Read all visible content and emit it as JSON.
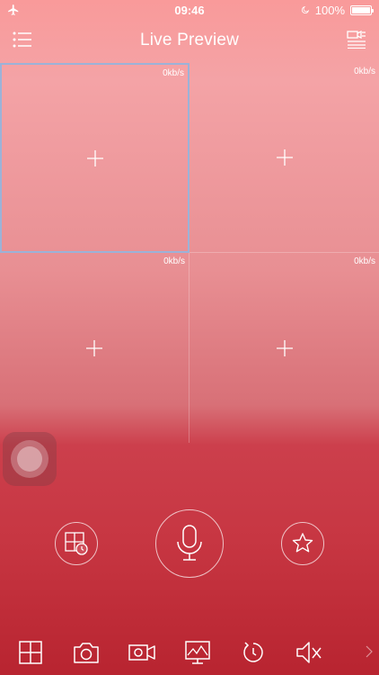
{
  "status_bar": {
    "time": "09:46",
    "battery": "100%",
    "icons": [
      "airplane-icon",
      "moon-icon",
      "battery-icon"
    ]
  },
  "nav": {
    "title": "Live Preview",
    "left_icon": "device-list-icon",
    "right_icon": "channel-list-icon"
  },
  "grid": {
    "cells": [
      {
        "rate": "0kb/s",
        "selected": true
      },
      {
        "rate": "0kb/s",
        "selected": false
      },
      {
        "rate": "0kb/s",
        "selected": false
      },
      {
        "rate": "0kb/s",
        "selected": false
      }
    ]
  },
  "controls": {
    "playback_icon": "playback-icon",
    "talk_icon": "microphone-icon",
    "favorite_icon": "star-icon"
  },
  "toolbar": {
    "items": [
      "split-screen-icon",
      "snapshot-icon",
      "record-icon",
      "quality-icon",
      "ptz-icon",
      "mute-icon"
    ]
  },
  "colors": {
    "top": "#f99a9a",
    "bottom": "#b82430",
    "selected_border": "#9cb2d8"
  }
}
